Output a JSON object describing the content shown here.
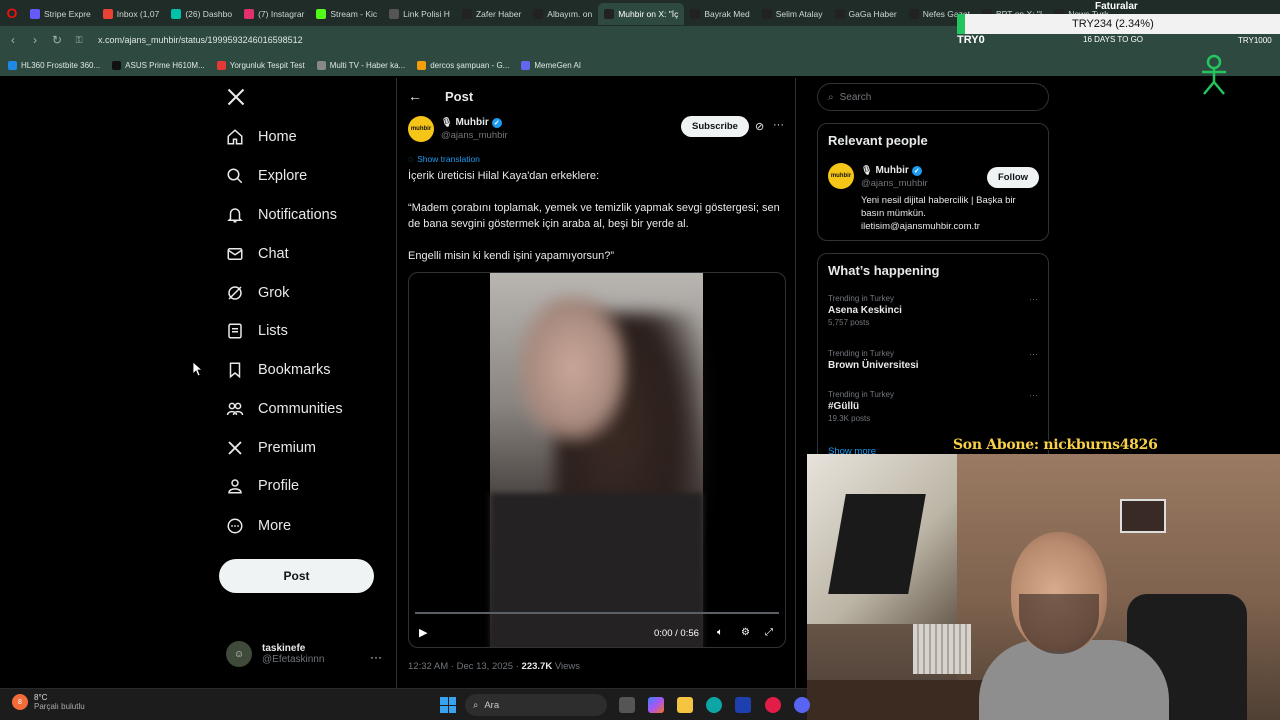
{
  "browser": {
    "tabs": [
      {
        "label": "Stripe Expre",
        "color": "#635bff"
      },
      {
        "label": "Inbox (1,07",
        "color": "#ea4335"
      },
      {
        "label": "(26) Dashbo",
        "color": "#00c2a8"
      },
      {
        "label": "(7) Instagrar",
        "color": "#e1306c"
      },
      {
        "label": "Stream - Kic",
        "color": "#53fc18"
      },
      {
        "label": "Link Polisi H",
        "color": "#555555"
      },
      {
        "label": "Zafer Haber",
        "color": "#222222"
      },
      {
        "label": "Albayım. on",
        "color": "#222222"
      },
      {
        "label": "Muhbir on X: \"İç",
        "color": "#222222",
        "active": true
      },
      {
        "label": "Bayrak Med",
        "color": "#222222"
      },
      {
        "label": "Selim Atalay",
        "color": "#222222"
      },
      {
        "label": "GaGa Haber",
        "color": "#222222"
      },
      {
        "label": "Nefes Gazet",
        "color": "#222222"
      },
      {
        "label": "BPT on X: \"I",
        "color": "#222222"
      },
      {
        "label": "News Turk",
        "color": "#222222"
      }
    ],
    "url": "x.com/ajans_muhbir/status/1999593246016598512",
    "bookmarks": [
      {
        "label": "HL360 Frostbite 360...",
        "color": "#1e88e5"
      },
      {
        "label": "ASUS Prime H610M...",
        "color": "#111111"
      },
      {
        "label": "Yorgunluk Tespit Test",
        "color": "#e53935"
      },
      {
        "label": "Multi TV - Haber ka...",
        "color": "#888888"
      },
      {
        "label": "dercos şampuan - G...",
        "color": "#f59e0b"
      },
      {
        "label": "MemeGen AI",
        "color": "#6366f1"
      }
    ]
  },
  "overlay": {
    "ticker": "TRY234 (2.34%)",
    "try0": "TRY0",
    "days": "16 DAYS TO GO",
    "faturalar": "Faturalar",
    "try1000": "TRY1000"
  },
  "nav": {
    "items": [
      {
        "label": "Home",
        "icon": "home-icon"
      },
      {
        "label": "Explore",
        "icon": "search-icon"
      },
      {
        "label": "Notifications",
        "icon": "bell-icon"
      },
      {
        "label": "Chat",
        "icon": "mail-icon"
      },
      {
        "label": "Grok",
        "icon": "grok-icon"
      },
      {
        "label": "Lists",
        "icon": "list-icon"
      },
      {
        "label": "Bookmarks",
        "icon": "bookmark-icon"
      },
      {
        "label": "Communities",
        "icon": "people-icon"
      },
      {
        "label": "Premium",
        "icon": "x-logo-icon"
      },
      {
        "label": "Profile",
        "icon": "person-icon"
      },
      {
        "label": "More",
        "icon": "more-circle-icon"
      }
    ],
    "post_button": "Post",
    "account_name": "taskinefe",
    "account_handle": "@Efetaskinnn"
  },
  "post": {
    "header": "Post",
    "author_name": "Muhbir",
    "author_handle": "@ajans_muhbir",
    "avatar_text": "muhbir",
    "subscribe": "Subscribe",
    "show_translation": "Show translation",
    "text1": "İçerik üreticisi Hilal Kaya'dan erkeklere:",
    "text2": "“Madem çorabını toplamak, yemek ve temizlik yapmak sevgi göstergesi; sen de bana sevgini göstermek için araba al, beşi bir yerde al.",
    "text3": "Engelli misin ki kendi işini yapamıyorsun?”",
    "video_time": "0:00 / 0:56",
    "meta_time": "12:32 AM · Dec 13, 2025 · ",
    "views_count": "223.7K",
    "views_label": "Views"
  },
  "right": {
    "search_placeholder": "Search",
    "relevant_title": "Relevant people",
    "rel_name": "Muhbir",
    "rel_handle": "@ajans_muhbir",
    "follow": "Follow",
    "rel_bio": "Yeni nesil dijital habercilik | Başka bir basın mümkün. iletisim@ajansmuhbir.com.tr",
    "happening_title": "What’s happening",
    "trends": [
      {
        "context": "Trending in Turkey",
        "name": "Asena Keskinci",
        "count": "5,757 posts"
      },
      {
        "context": "Trending in Turkey",
        "name": "Brown Üniversitesi",
        "count": ""
      },
      {
        "context": "Trending in Turkey",
        "name": "#Güllü",
        "count": "19.3K posts"
      }
    ],
    "show_more": "Show more"
  },
  "stream": {
    "subtitle": "Son Abone: nickburns4826"
  },
  "taskbar": {
    "weather_temp": "8°C",
    "weather_desc": "Parçalı bulutlu",
    "weather_badge": "8",
    "search_placeholder": "Ara"
  }
}
